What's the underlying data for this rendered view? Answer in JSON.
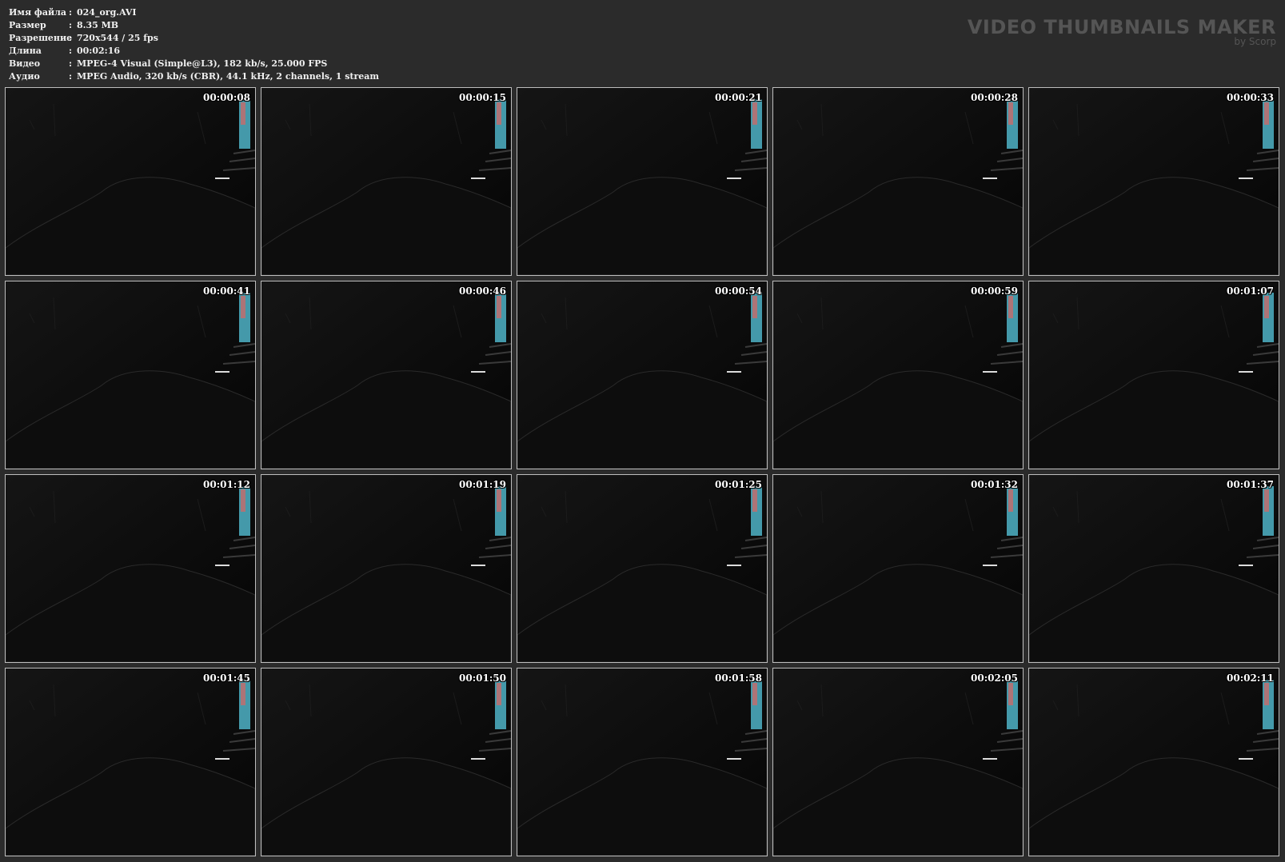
{
  "file_info": [
    {
      "label": "Имя файла",
      "sep": ":",
      "value": "024_org.AVI"
    },
    {
      "label": "Размер",
      "sep": ":",
      "value": "8.35 MB"
    },
    {
      "label": "Разрешение",
      "sep": ":",
      "value": "720x544 / 25 fps"
    },
    {
      "label": "Длина",
      "sep": ":",
      "value": "00:02:16"
    },
    {
      "label": "Видео",
      "sep": ":",
      "value": "MPEG-4 Visual (Simple@L3), 182 kb/s, 25.000 FPS"
    },
    {
      "label": "Аудио",
      "sep": ":",
      "value": "MPEG Audio, 320 kb/s (CBR), 44.1 kHz, 2 channels, 1 stream"
    }
  ],
  "brand": {
    "title": "VIDEO THUMBNAILS MAKER",
    "subtitle": "by Scorp"
  },
  "thumbnails": [
    {
      "timestamp": "00:00:08"
    },
    {
      "timestamp": "00:00:15"
    },
    {
      "timestamp": "00:00:21"
    },
    {
      "timestamp": "00:00:28"
    },
    {
      "timestamp": "00:00:33"
    },
    {
      "timestamp": "00:00:41"
    },
    {
      "timestamp": "00:00:46"
    },
    {
      "timestamp": "00:00:54"
    },
    {
      "timestamp": "00:00:59"
    },
    {
      "timestamp": "00:01:07"
    },
    {
      "timestamp": "00:01:12"
    },
    {
      "timestamp": "00:01:19"
    },
    {
      "timestamp": "00:01:25"
    },
    {
      "timestamp": "00:01:32"
    },
    {
      "timestamp": "00:01:37"
    },
    {
      "timestamp": "00:01:45"
    },
    {
      "timestamp": "00:01:50"
    },
    {
      "timestamp": "00:01:58"
    },
    {
      "timestamp": "00:02:05"
    },
    {
      "timestamp": "00:02:11"
    }
  ],
  "colors": {
    "background": "#2b2b2b",
    "frame_border": "#bdbdbd",
    "screen_glow": "#4fb3c7",
    "led_blue": "#3a5cff"
  }
}
